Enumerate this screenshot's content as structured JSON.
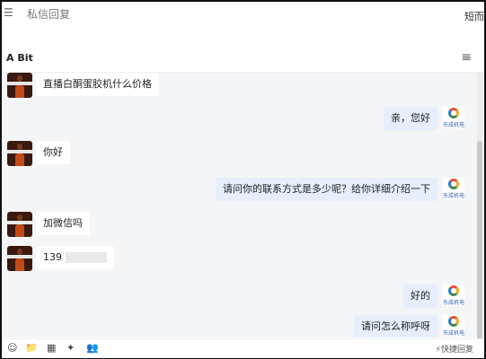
{
  "topbar": {
    "left_icon": "☰",
    "title": "私信回复",
    "right_text": "短而"
  },
  "conversation": {
    "name": "A Bit",
    "menu_icon": "≡"
  },
  "messages": [
    {
      "side": "left",
      "text": "直播白酮蛋胶机什么价格"
    },
    {
      "side": "right",
      "text": "亲，您好"
    },
    {
      "side": "left",
      "text": "你好"
    },
    {
      "side": "right",
      "text": "请问你的联系方式是多少呢？给你详细介绍一下"
    },
    {
      "side": "left",
      "text": "加微信吗"
    },
    {
      "side": "left",
      "text": "139"
    },
    {
      "side": "right",
      "text": "好的"
    },
    {
      "side": "right",
      "text": "请问怎么称呼呀"
    }
  ],
  "footer": {
    "icons": [
      "☺",
      "📁",
      "▦",
      "✦",
      "👥"
    ],
    "quick_reply": "⚡快捷回复"
  }
}
